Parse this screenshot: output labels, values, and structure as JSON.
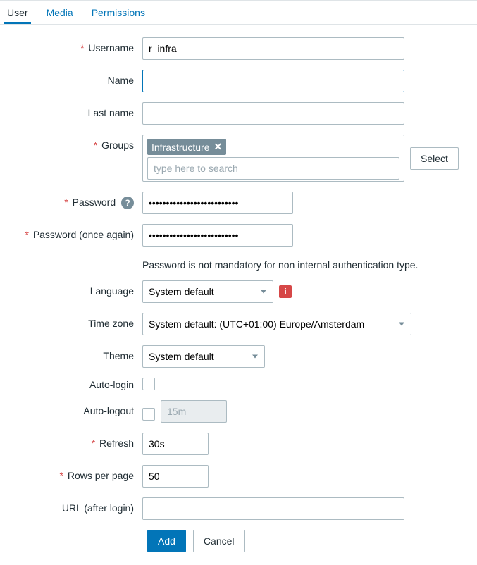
{
  "tabs": {
    "user": "User",
    "media": "Media",
    "permissions": "Permissions"
  },
  "labels": {
    "username": "Username",
    "name": "Name",
    "lastname": "Last name",
    "groups": "Groups",
    "password": "Password",
    "password2": "Password (once again)",
    "language": "Language",
    "timezone": "Time zone",
    "theme": "Theme",
    "autologin": "Auto-login",
    "autologout": "Auto-logout",
    "refresh": "Refresh",
    "rowsperpage": "Rows per page",
    "urlafterlogin": "URL (after login)"
  },
  "values": {
    "username": "r_infra",
    "name": "",
    "lastname": "",
    "group_chip": "Infrastructure",
    "groups_placeholder": "type here to search",
    "password_mask": "••••••••••••••••••••••••••",
    "language": "System default",
    "timezone": "System default: (UTC+01:00) Europe/Amsterdam",
    "theme": "System default",
    "autologout": "15m",
    "refresh": "30s",
    "rowsperpage": "50",
    "urlafterlogin": ""
  },
  "hints": {
    "password_note": "Password is not mandatory for non internal authentication type."
  },
  "buttons": {
    "select": "Select",
    "add": "Add",
    "cancel": "Cancel"
  },
  "icons": {
    "help": "?",
    "info": "i",
    "chip_close": "✕"
  }
}
